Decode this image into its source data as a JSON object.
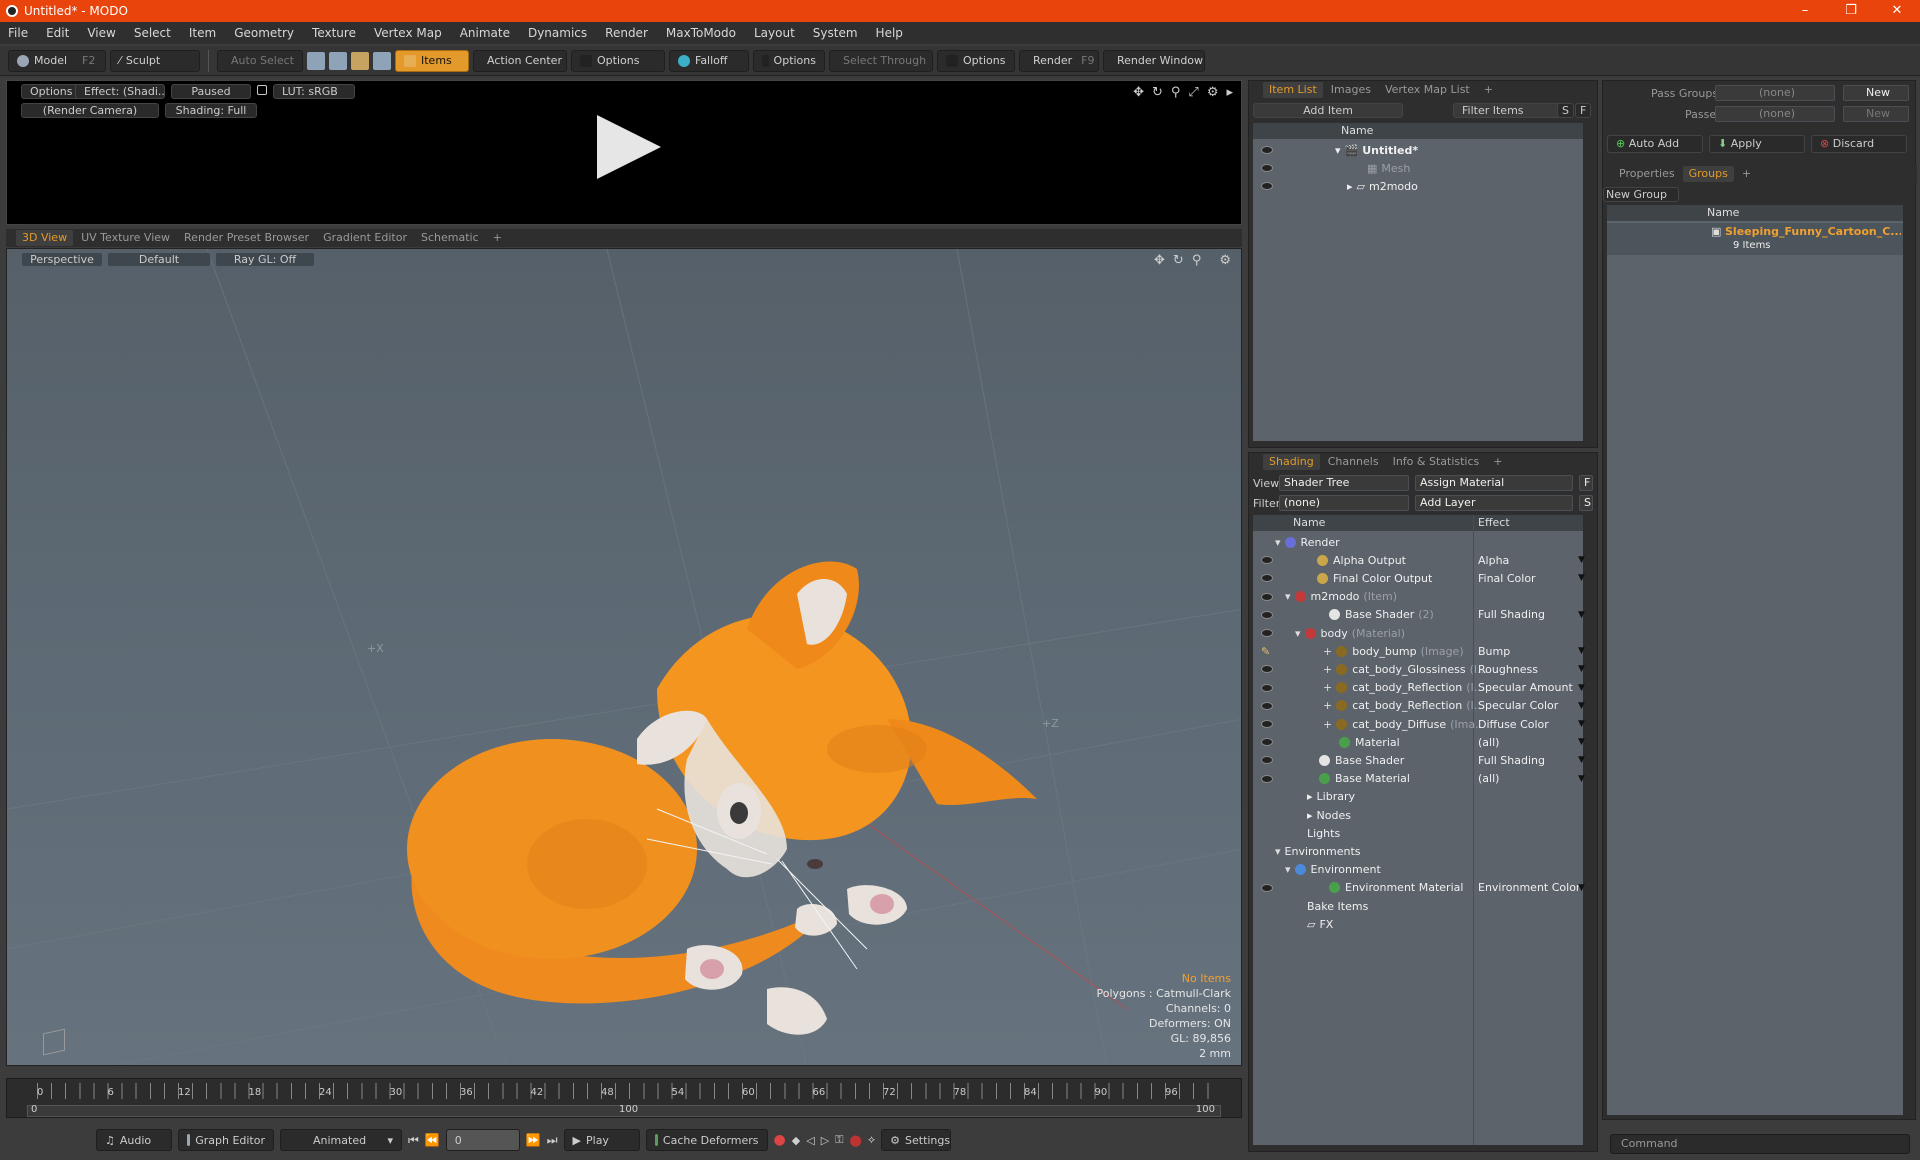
{
  "window": {
    "title": "Untitled* - MODO",
    "controls": [
      "–",
      "❐",
      "✕"
    ]
  },
  "menu": [
    "File",
    "Edit",
    "View",
    "Select",
    "Item",
    "Geometry",
    "Texture",
    "Vertex Map",
    "Animate",
    "Dynamics",
    "Render",
    "MaxToModo",
    "Layout",
    "System",
    "Help"
  ],
  "toolbar": {
    "model": "Model",
    "model_key": "F2",
    "sculpt": "Sculpt",
    "auto_select": "Auto Select",
    "items": "Items",
    "action_center": "Action Center",
    "options1": "Options",
    "falloff": "Falloff",
    "options2": "Options",
    "select_through": "Select Through",
    "options3": "Options",
    "render": "Render",
    "render_key": "F9",
    "render_window": "Render Window"
  },
  "preview": {
    "options": "Options",
    "effect": "Effect: (Shadi...",
    "paused": "Paused",
    "lut": "LUT: sRGB",
    "camera": "(Render Camera)",
    "shading": "Shading: Full"
  },
  "view_tabs": [
    "3D View",
    "UV Texture View",
    "Render Preset Browser",
    "Gradient Editor",
    "Schematic",
    "+"
  ],
  "viewport": {
    "perspective": "Perspective",
    "default": "Default",
    "raygl": "Ray GL: Off",
    "axis_x": "+X",
    "axis_z": "+Z",
    "hud": {
      "no_items": "No Items",
      "polygons": "Polygons : Catmull-Clark",
      "channels": "Channels: 0",
      "deformers": "Deformers: ON",
      "gl": "GL: 89,856",
      "units": "2 mm"
    }
  },
  "timeline": {
    "ticks": [
      "0",
      "6",
      "12",
      "18",
      "24",
      "30",
      "36",
      "42",
      "48",
      "54",
      "60",
      "66",
      "72",
      "78",
      "84",
      "90",
      "96"
    ],
    "start": "0",
    "mid": "100",
    "end": "100"
  },
  "bottombar": {
    "audio": "Audio",
    "graph_editor": "Graph Editor",
    "animated": "Animated",
    "frame": "0",
    "play": "Play",
    "cache": "Cache Deformers",
    "settings": "Settings"
  },
  "itemlist": {
    "tabs": [
      "Item List",
      "Images",
      "Vertex Map List",
      "+"
    ],
    "add_item": "Add Item",
    "filter_items": "Filter Items",
    "s": "S",
    "f": "F",
    "name_col": "Name",
    "rows": [
      {
        "label": "Untitled*"
      },
      {
        "label": "Mesh"
      },
      {
        "label": "m2modo"
      }
    ]
  },
  "shading": {
    "tabs": [
      "Shading",
      "Channels",
      "Info & Statistics",
      "+"
    ],
    "view_label": "View",
    "view_value": "Shader Tree",
    "assign": "Assign Material",
    "f": "F",
    "filter_label": "Filter",
    "filter_value": "(none)",
    "add_layer": "Add Layer",
    "s": "S",
    "name_col": "Name",
    "effect_col": "Effect",
    "rows": [
      {
        "name": "Render",
        "effect": ""
      },
      {
        "name": "Alpha Output",
        "effect": "Alpha"
      },
      {
        "name": "Final Color Output",
        "effect": "Final Color"
      },
      {
        "name": "m2modo",
        "suffix": "(Item)",
        "effect": ""
      },
      {
        "name": "Base Shader",
        "suffix": "(2)",
        "effect": "Full Shading"
      },
      {
        "name": "body",
        "suffix": "(Material)",
        "effect": ""
      },
      {
        "name": "body_bump",
        "suffix": "(Image)",
        "effect": "Bump"
      },
      {
        "name": "cat_body_Glossiness",
        "suffix": "(I...",
        "effect": "Roughness"
      },
      {
        "name": "cat_body_Reflection",
        "suffix": "(I...",
        "effect": "Specular Amount"
      },
      {
        "name": "cat_body_Reflection",
        "suffix": "(I...",
        "effect": "Specular Color"
      },
      {
        "name": "cat_body_Diffuse",
        "suffix": "(Ima...",
        "effect": "Diffuse Color"
      },
      {
        "name": "Material",
        "effect": "(all)"
      },
      {
        "name": "Base Shader",
        "effect": "Full Shading"
      },
      {
        "name": "Base Material",
        "effect": "(all)"
      },
      {
        "name": "Library",
        "effect": ""
      },
      {
        "name": "Nodes",
        "effect": ""
      },
      {
        "name": "Lights",
        "effect": ""
      },
      {
        "name": "Environments",
        "effect": ""
      },
      {
        "name": "Environment",
        "effect": ""
      },
      {
        "name": "Environment Material",
        "effect": "Environment Color"
      },
      {
        "name": "Bake Items",
        "effect": ""
      },
      {
        "name": "FX",
        "effect": ""
      }
    ]
  },
  "groups": {
    "pass_groups": "Pass Groups",
    "passes": "Passes",
    "none": "(none)",
    "new": "New",
    "auto_add": "Auto Add",
    "apply": "Apply",
    "discard": "Discard",
    "tabs": [
      "Properties",
      "Groups",
      "+"
    ],
    "new_group": "New Group",
    "name_col": "Name",
    "group_name": "Sleeping_Funny_Cartoon_C...",
    "group_count": "9 Items"
  },
  "command": {
    "placeholder": "Command"
  },
  "colors": {
    "accent": "#e39a2a",
    "titlebar": "#e8440b",
    "cat": "#f08a1c"
  }
}
